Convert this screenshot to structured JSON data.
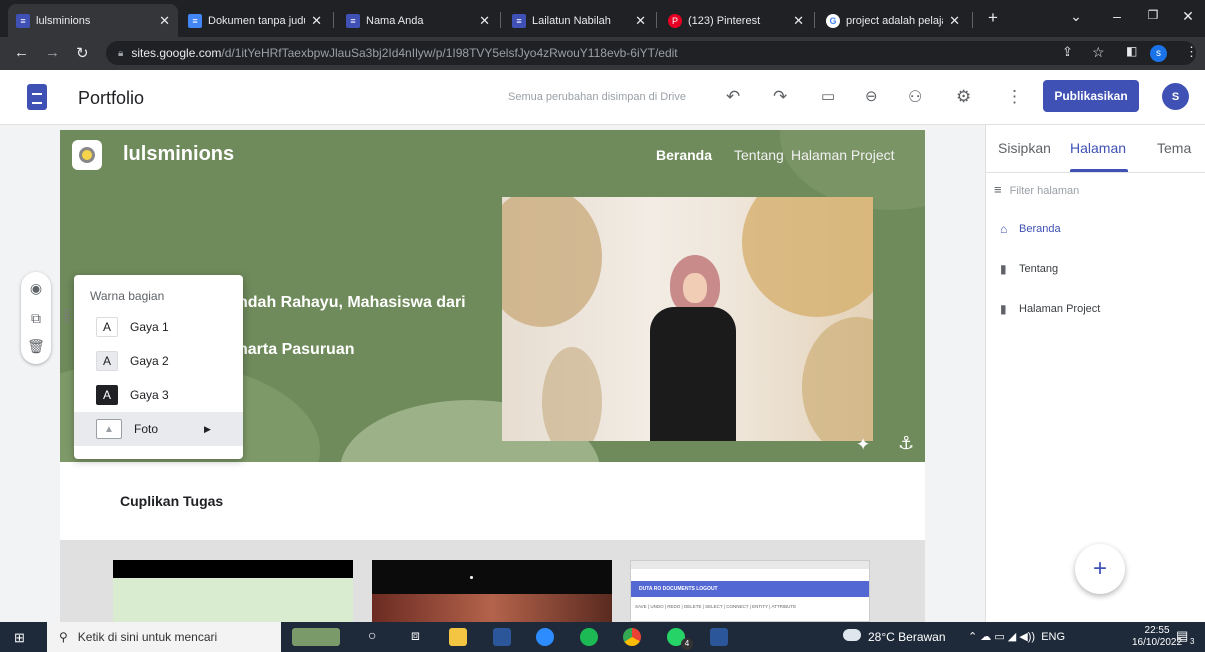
{
  "browser": {
    "tabs": [
      {
        "title": "lulsminions",
        "icon": "sites-icon",
        "color": "#3f51b5"
      },
      {
        "title": "Dokumen tanpa judul",
        "icon": "docs-icon",
        "color": "#4285f4"
      },
      {
        "title": "Nama Anda",
        "icon": "sites-icon",
        "color": "#3f51b5"
      },
      {
        "title": "Lailatun Nabilah",
        "icon": "sites-icon",
        "color": "#3f51b5"
      },
      {
        "title": "(123) Pinterest",
        "icon": "pinterest-icon",
        "color": "#e60023"
      },
      {
        "title": "project adalah pelajar",
        "icon": "google-icon",
        "color": "#ffffff"
      }
    ],
    "url_host": "sites.google.com",
    "url_path": "/d/1itYeHRfTaexbpwJlauSa3bj2Id4nIlyw/p/1I98TVY5elsfJyo4zRwouY118evb-6iYT/edit",
    "profile_initial": "s"
  },
  "editor": {
    "title": "Portfolio",
    "save_status": "Semua perubahan disimpan di Drive",
    "publish_label": "Publikasikan",
    "avatar_initial": "S"
  },
  "site": {
    "name": "lulsminions",
    "nav": [
      "Beranda",
      "Tentang",
      "Halaman Project"
    ],
    "hero_line1": "ndah Rahayu, Mahasiswa dari",
    "hero_line2": "harta Pasuruan",
    "section_heading": "Cuplikan Tugas",
    "thumb3_bar": "DUTA RO   DOCUMENTS   LOGOUT",
    "thumb3_buttons": [
      "SAVE",
      "UNDO",
      "REDO",
      "DELETE",
      "SELECT",
      "CONNECT",
      "ENTITY",
      "ATTRIBUTE"
    ]
  },
  "color_menu": {
    "title": "Warna bagian",
    "items": [
      {
        "label": "Gaya 1",
        "glyph": "A"
      },
      {
        "label": "Gaya 2",
        "glyph": "A"
      },
      {
        "label": "Gaya 3",
        "glyph": "A"
      },
      {
        "label": "Foto",
        "glyph": ""
      }
    ]
  },
  "panel": {
    "tabs": [
      "Sisipkan",
      "Halaman",
      "Tema"
    ],
    "active_tab": "Halaman",
    "filter_placeholder": "Filter halaman",
    "pages": [
      "Beranda",
      "Tentang",
      "Halaman Project"
    ],
    "fab": "+"
  },
  "taskbar": {
    "search_placeholder": "Ketik di sini untuk mencari",
    "weather": "28°C  Berawan",
    "lang": "ENG",
    "time": "22:55",
    "date": "16/10/2022",
    "whatsapp_badge": "4",
    "notification_count": "3"
  },
  "colors": {
    "accent": "#3f51b5",
    "hero": "#6f8a5b"
  }
}
